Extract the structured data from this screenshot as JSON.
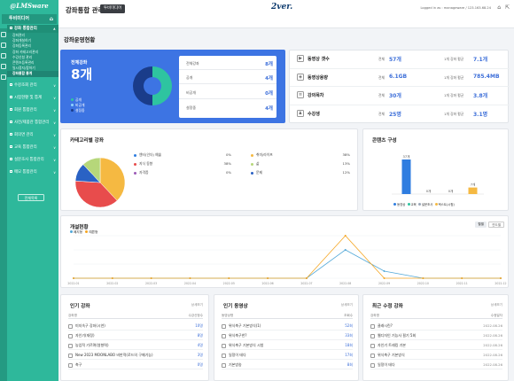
{
  "sidebar": {
    "brand": "@LMSware",
    "title": "투비미디어",
    "menu": [
      {
        "label": "강좌 통합관리",
        "caret": "∧",
        "active": true
      },
      {
        "label": "수강조회 관리",
        "caret": "∨"
      },
      {
        "label": "시험현황 및 통계",
        "caret": "∨"
      },
      {
        "label": "회원 통합관리",
        "caret": "∨"
      },
      {
        "label": "사전/제품관 통합관리",
        "caret": "∨"
      },
      {
        "label": "회의면 관리",
        "caret": "∨"
      },
      {
        "label": "교육 통합관리",
        "caret": "∨"
      },
      {
        "label": "설문조사 통합관리",
        "caret": "∨"
      },
      {
        "label": "메모 통합관리",
        "caret": "∨"
      }
    ],
    "submenu": [
      {
        "label": "강좌관리"
      },
      {
        "label": "강좌개설하기"
      },
      {
        "label": "강좌등록관리"
      },
      {
        "label": "강좌 카테고리관리"
      },
      {
        "label": "수강신청 관리"
      },
      {
        "label": "콘텐츠등록관리"
      },
      {
        "label": "일시정지/팝하기"
      },
      {
        "label": "강좌통합 통계",
        "active": true
      }
    ],
    "all_button": "전체목록"
  },
  "topbar": {
    "title": "강좌통합 관리",
    "org_button": "투비미디어",
    "logo": "2ver.",
    "login_info": "Logged in as : manageware / 123.163.68.24",
    "home_icon": "⌂",
    "logout_icon": "⇱"
  },
  "section_title": "강좌운영현황",
  "course_summary": {
    "label": "전체강좌",
    "value": "8개",
    "legend": [
      {
        "label": "공개",
        "color": "#2ec4a0"
      },
      {
        "label": "비공개",
        "color": "#8fd3ff"
      },
      {
        "label": "설정중",
        "color": "#1a3c8a"
      }
    ],
    "donut": [
      {
        "label": "공개",
        "value": 4,
        "color": "#2ec4a0"
      },
      {
        "label": "비공개",
        "value": 0,
        "color": "#8fd3ff"
      },
      {
        "label": "설정중",
        "value": 4,
        "color": "#1a3c8a"
      }
    ],
    "rows": [
      {
        "label": "전체강좌",
        "value": "8개"
      },
      {
        "label": "공개",
        "value": "4개"
      },
      {
        "label": "비공개",
        "value": "0개"
      },
      {
        "label": "설정중",
        "value": "4개"
      }
    ]
  },
  "stats": [
    {
      "icon": "▶",
      "title": "동영상 갯수",
      "label1": "전체",
      "value1": "57개",
      "label2": "1개 강좌 평균",
      "value2": "7.1개"
    },
    {
      "icon": "◈",
      "title": "동영상용량",
      "label1": "전체",
      "value1": "6.1GB",
      "label2": "1개 강좌 평균",
      "value2": "785.4MB"
    },
    {
      "icon": "≡",
      "title": "강의목차",
      "label1": "전체",
      "value1": "30개",
      "label2": "1개 강좌 평균",
      "value2": "3.8개"
    },
    {
      "icon": "♟",
      "title": "수강생",
      "label1": "전체",
      "value1": "25명",
      "label2": "1개 강좌 평균",
      "value2": "3.1명"
    }
  ],
  "category": {
    "title": "카테고리별 강좌",
    "legend_left": [
      {
        "label": "엔터(인더) 예술",
        "pct": "0%",
        "color": "#2f7de0"
      },
      {
        "label": "지식 동향",
        "pct": "38%",
        "color": "#e84c4c"
      },
      {
        "label": "자격증",
        "pct": "0%",
        "color": "#9b59b6"
      }
    ],
    "legend_right": [
      {
        "label": "취미/라이프",
        "pct": "38%",
        "color": "#f5b942"
      },
      {
        "label": "삶",
        "pct": "13%",
        "color": "#b6d77a"
      },
      {
        "label": "문제",
        "pct": "12%",
        "color": "#2a62c4"
      }
    ]
  },
  "chart_data": [
    {
      "type": "pie",
      "title": "카테고리별 강좌",
      "categories": [
        "취미/라이프",
        "지식 동향",
        "문제",
        "삶"
      ],
      "values": [
        38,
        38,
        12,
        12
      ],
      "colors": [
        "#f5b942",
        "#e84c4c",
        "#2a62c4",
        "#b6d77a"
      ]
    },
    {
      "type": "bar",
      "title": "콘텐츠 구성",
      "categories": [
        "동영상",
        "교육",
        "설문조사",
        "텍스트(시험)"
      ],
      "values": [
        37,
        0,
        0,
        7
      ],
      "data_labels": [
        "37개",
        "0개",
        "0개",
        "7개"
      ],
      "colors": [
        "#2f7de0",
        "#2ec4a0",
        "#9aa7b8",
        "#f5b942"
      ]
    },
    {
      "type": "line",
      "title": "개설현황",
      "x": [
        "2022.01",
        "2022.02",
        "2022.03",
        "2022.04",
        "2022.05",
        "2022.06",
        "2022.07",
        "2022.08",
        "2022.09",
        "2022.10",
        "2022.11",
        "2022.12"
      ],
      "series": [
        {
          "name": "폐지형",
          "color": "#52a8d8",
          "values": [
            0,
            0,
            0,
            0,
            0,
            0,
            0,
            4,
            1,
            0,
            0,
            0
          ]
        },
        {
          "name": "예쁜형",
          "color": "#f5a623",
          "values": [
            0,
            0,
            0,
            0,
            0,
            0,
            0,
            6,
            0,
            0,
            0,
            0
          ]
        }
      ],
      "ylim": [
        0,
        6
      ]
    }
  ],
  "content": {
    "title": "콘텐츠 구성",
    "legend": [
      {
        "label": "동영상",
        "color": "#2f7de0"
      },
      {
        "label": "교육",
        "color": "#2ec4a0"
      },
      {
        "label": "설문조사",
        "color": "#9aa7b8"
      },
      {
        "label": "텍스트(시험)",
        "color": "#f5b942"
      }
    ]
  },
  "timeline": {
    "title": "개설현황",
    "tag1": "월별",
    "tag2": "연도별"
  },
  "popular_courses": {
    "title": "인기 강좌",
    "more": "상세보기",
    "col1": "강좌명",
    "col2": "수강신청수",
    "rows": [
      {
        "name": "미지속구 강좌(시연)",
        "value": "10명"
      },
      {
        "name": "자인기(재정)",
        "value": "8명"
      },
      {
        "name": "농업적 기르며(영향력)",
        "value": "4명"
      },
      {
        "name": "New 2023 MOONLABO 비판적(로드의 구매기능)",
        "value": "3명"
      },
      {
        "name": "축구",
        "value": "0명"
      }
    ]
  },
  "popular_videos": {
    "title": "인기 동영상",
    "more": "상세보기",
    "col1": "동영상명",
    "col2": "조회수",
    "rows": [
      {
        "name": "위식축구 기본방식(1)",
        "value": "52회"
      },
      {
        "name": "위식축구한?",
        "value": "33회"
      },
      {
        "name": "위식축구 기본방식 시청",
        "value": "18회"
      },
      {
        "name": "일정이 테다",
        "value": "17회"
      },
      {
        "name": "기본방송",
        "value": "8회"
      }
    ]
  },
  "recent_courses": {
    "title": "최근 수정 강좌",
    "more": "상세보기",
    "col1": "강좌명",
    "col2": "수정일자",
    "rows": [
      {
        "name": "클래시린?",
        "date": "2022.08.26"
      },
      {
        "name": "웹디자인 기능사 필기 5회",
        "date": "2022.08.26"
      },
      {
        "name": "자인기 트래킹 기본",
        "date": "2022.08.26"
      },
      {
        "name": "위식축구 기본방식",
        "date": "2022.08.26"
      },
      {
        "name": "일정이 테다",
        "date": "2022.08.26"
      }
    ]
  }
}
